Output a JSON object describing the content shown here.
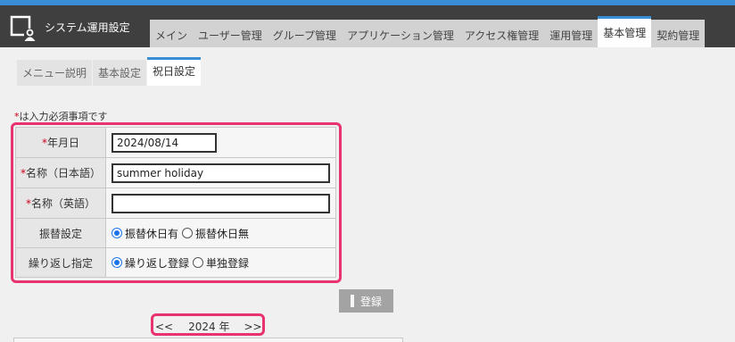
{
  "app": {
    "title": "システム運用設定"
  },
  "main_tabs": [
    {
      "label": "メイン"
    },
    {
      "label": "ユーザー管理"
    },
    {
      "label": "グループ管理"
    },
    {
      "label": "アプリケーション管理"
    },
    {
      "label": "アクセス権管理"
    },
    {
      "label": "運用管理"
    },
    {
      "label": "基本管理",
      "active": true
    },
    {
      "label": "契約管理"
    }
  ],
  "sub_tabs": [
    {
      "label": "メニュー説明"
    },
    {
      "label": "基本設定"
    },
    {
      "label": "祝日設定",
      "active": true
    }
  ],
  "form": {
    "required_mark": "*",
    "required_note": "は入力必須事項です",
    "date": {
      "label": "年月日",
      "value": "2024/08/14"
    },
    "name_ja": {
      "label": "名称（日本語）",
      "value": "summer holiday"
    },
    "name_en": {
      "label": "名称（英語）",
      "value": ""
    },
    "substitute": {
      "label": "振替設定",
      "options": [
        {
          "label": "振替休日有",
          "checked": true
        },
        {
          "label": "振替休日無",
          "checked": false
        }
      ]
    },
    "repeat": {
      "label": "繰り返し指定",
      "options": [
        {
          "label": "繰り返し登録",
          "checked": true
        },
        {
          "label": "単独登録",
          "checked": false
        }
      ]
    },
    "submit_label": "登録"
  },
  "year_nav": {
    "prev": "<<",
    "year": "2024 年",
    "next": ">>"
  },
  "colors": {
    "accent": "#3a8ed6",
    "highlight": "#e8336e",
    "required": "#d0021b",
    "header_bg": "#3f3f3f"
  }
}
